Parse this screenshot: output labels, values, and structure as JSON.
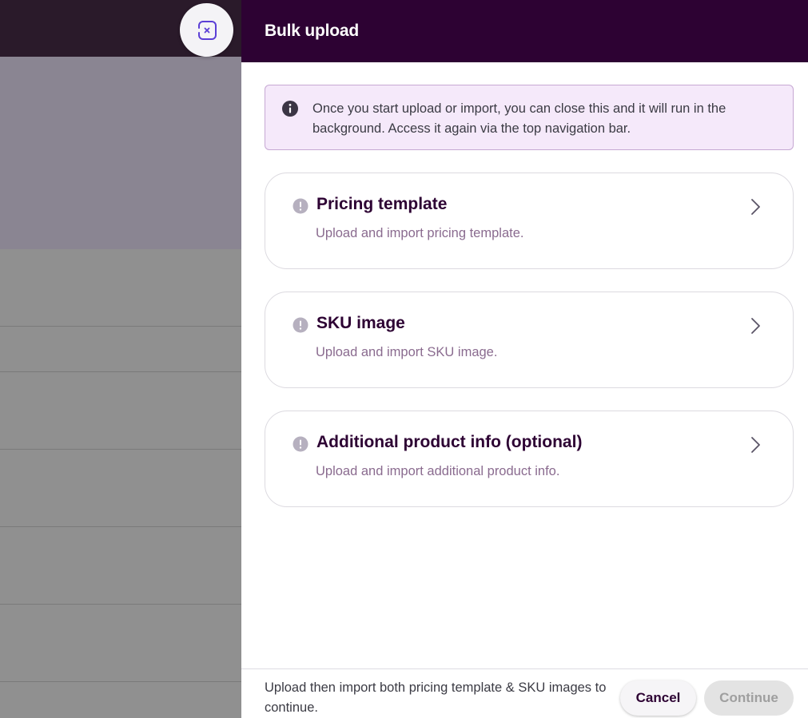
{
  "drawer": {
    "title": "Bulk upload",
    "info_message": "Once you start upload or import, you can close this and it will run in the background. Access it again via the top navigation bar.",
    "cards": [
      {
        "title": "Pricing template",
        "subtitle": "Upload and import pricing template."
      },
      {
        "title": "SKU image",
        "subtitle": "Upload and import SKU image."
      },
      {
        "title": "Additional product info (optional)",
        "subtitle": "Upload and import additional product info."
      }
    ],
    "footer": {
      "hint": "Upload then import both pricing template & SKU images to continue.",
      "cancel_label": "Cancel",
      "continue_label": "Continue"
    }
  },
  "icons": {
    "collapse": "close-drawer-icon",
    "info": "info-icon",
    "status": "alert-circle-icon",
    "chevron": "chevron-right-icon"
  },
  "colors": {
    "header_bg": "#2d0233",
    "info_bg": "#f5e9fa",
    "accent_icon": "#5b3fd6",
    "title_text": "#2d0233",
    "subtitle_text": "#8a6b8f",
    "status_icon": "#b6b0bf"
  }
}
